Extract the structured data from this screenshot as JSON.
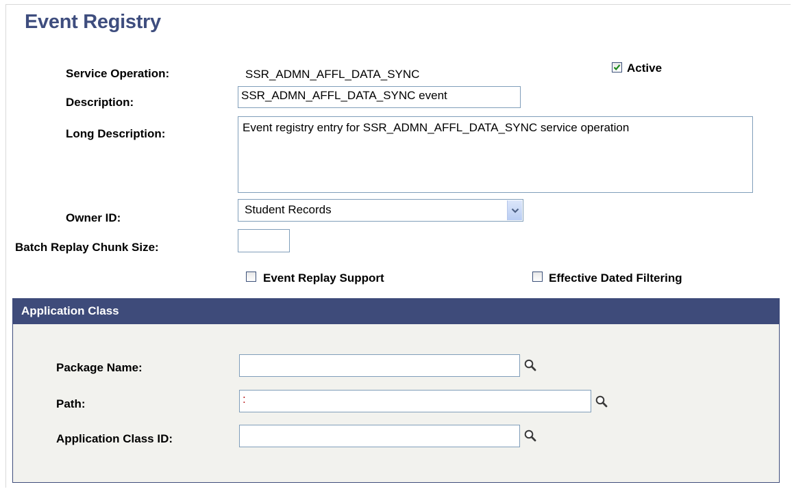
{
  "page_title": "Event Registry",
  "fields": {
    "service_operation": {
      "label": "Service Operation:",
      "value": "SSR_ADMN_AFFL_DATA_SYNC"
    },
    "active": {
      "label": "Active",
      "checked": true
    },
    "description": {
      "label": "Description:",
      "value": "SSR_ADMN_AFFL_DATA_SYNC event"
    },
    "long_description": {
      "label": "Long Description:",
      "value": "Event registry entry for SSR_ADMN_AFFL_DATA_SYNC service operation"
    },
    "owner_id": {
      "label": "Owner ID:",
      "value": "Student Records"
    },
    "batch_replay_chunk_size": {
      "label": "Batch Replay Chunk Size:",
      "value": ""
    },
    "event_replay_support": {
      "label": "Event Replay Support",
      "checked": false
    },
    "effective_dated_filtering": {
      "label": "Effective Dated Filtering",
      "checked": false
    }
  },
  "application_class": {
    "header": "Application Class",
    "package_name": {
      "label": "Package Name:",
      "value": ""
    },
    "path": {
      "label": "Path:",
      "value": ":"
    },
    "app_class_id": {
      "label": "Application Class ID:",
      "value": ""
    }
  },
  "icons": {
    "lookup": "magnifier-icon",
    "dropdown": "chevron-down-icon",
    "check": "checkmark-icon"
  },
  "colors": {
    "title": "#3e4d7e",
    "section_header": "#3e4b7a",
    "section_body": "#f2f2ee",
    "field_border": "#7f9db9",
    "check_green": "#1e8a1e"
  }
}
